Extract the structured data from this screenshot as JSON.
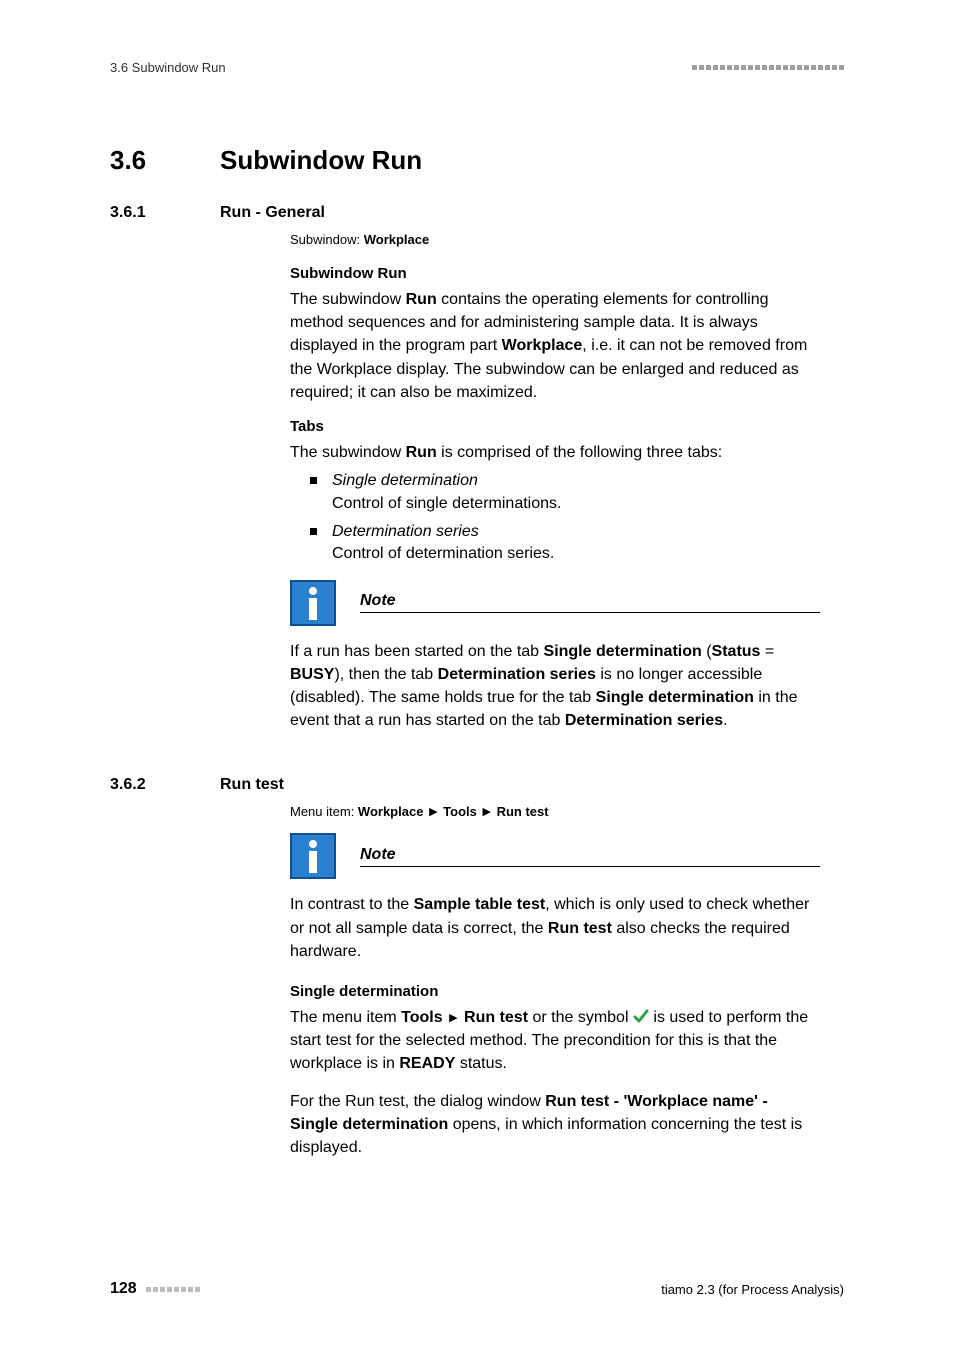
{
  "header": {
    "running": "3.6 Subwindow Run"
  },
  "section": {
    "num": "3.6",
    "title": "Subwindow Run"
  },
  "s361": {
    "num": "3.6.1",
    "title": "Run - General",
    "subwindow_label": "Subwindow: ",
    "subwindow_value": "Workplace",
    "h_subwindow_run": "Subwindow Run",
    "p_intro_1a": "The subwindow ",
    "p_intro_1b": "Run",
    "p_intro_1c": " contains the operating elements for controlling method sequences and for administering sample data. It is always displayed in the program part ",
    "p_intro_1d": "Workplace",
    "p_intro_1e": ", i.e. it can not be removed from the Workplace display. The subwindow can be enlarged and reduced as required; it can also be maximized.",
    "h_tabs": "Tabs",
    "p_tabs_a": "The subwindow ",
    "p_tabs_b": "Run",
    "p_tabs_c": " is comprised of the following three tabs:",
    "li1_term": "Single determination",
    "li1_desc": "Control of single determinations.",
    "li2_term": "Determination series",
    "li2_desc": "Control of determination series.",
    "note_label": "Note",
    "note_a": "If a run has been started on the tab ",
    "note_b": "Single determination",
    "note_c": " (",
    "note_d": "Status",
    "note_e": " = ",
    "note_f": "BUSY",
    "note_g": "), then the tab ",
    "note_h": "Determination series",
    "note_i": " is no longer accessible (disabled). The same holds true for the tab ",
    "note_j": "Single determination",
    "note_k": " in the event that a run has started on the tab ",
    "note_l": "Determination series",
    "note_m": "."
  },
  "s362": {
    "num": "3.6.2",
    "title": "Run test",
    "menu_label": "Menu item: ",
    "menu_1": "Workplace",
    "menu_2": "Tools",
    "menu_3": "Run test",
    "note_label": "Note",
    "note_a": "In contrast to the ",
    "note_b": "Sample table test",
    "note_c": ", which is only used to check whether or not all sample data is correct, the ",
    "note_d": "Run test",
    "note_e": " also checks the required hardware.",
    "h_single": "Single determination",
    "p1_a": "The menu item ",
    "p1_b": "Tools",
    "p1_c": "Run test",
    "p1_d": " or the symbol ",
    "p1_e": " is used to perform the start test for the selected method. The precondition for this is that the workplace is in ",
    "p1_f": "READY",
    "p1_g": " status.",
    "p2_a": "For the Run test, the dialog window ",
    "p2_b": "Run test - 'Workplace name' - Single determination",
    "p2_c": " opens, in which information concerning the test is displayed."
  },
  "footer": {
    "page": "128",
    "doc": "tiamo 2.3 (for Process Analysis)"
  }
}
